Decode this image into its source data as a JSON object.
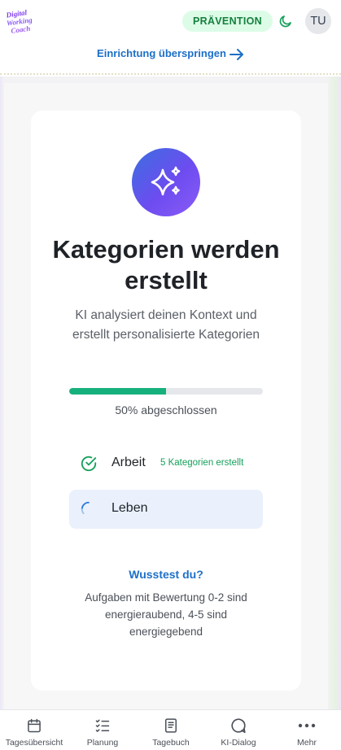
{
  "header": {
    "badge": "PRÄVENTION",
    "avatar_initials": "TU",
    "skip_link": "Einrichtung überspringen",
    "logo_lines": [
      "Digital",
      "Working",
      "Coach"
    ]
  },
  "card": {
    "title": "Kategorien werden erstellt",
    "subtitle": "KI analysiert deinen Kontext und erstellt personalisierte Kategorien",
    "progress": {
      "fraction": 0.5,
      "text": "50% abgeschlossen"
    },
    "steps": [
      {
        "label": "Arbeit",
        "status": "5 Kategorien erstellt",
        "state": "done",
        "icon": "check-circle-icon"
      },
      {
        "label": "Leben",
        "status": "",
        "state": "active",
        "icon": "spinner-icon"
      }
    ],
    "tip": {
      "title": "Wusstest du?",
      "text": "Aufgaben mit Bewertung 0-2 sind energieraubend, 4-5 sind energiegebend"
    }
  },
  "nav": [
    {
      "label": "Tagesübersicht",
      "icon": "calendar-icon"
    },
    {
      "label": "Planung",
      "icon": "checklist-icon"
    },
    {
      "label": "Tagebuch",
      "icon": "book-icon"
    },
    {
      "label": "KI-Dialog",
      "icon": "chat-icon"
    },
    {
      "label": "Mehr",
      "icon": "more-icon"
    }
  ],
  "colors": {
    "accent_blue": "#1d6fc8",
    "progress_green": "#16b07c",
    "badge_bg": "#dcfce7",
    "badge_text": "#15803d",
    "hero_gradient_start": "#3b6fe0",
    "hero_gradient_end": "#8b5cf6"
  }
}
